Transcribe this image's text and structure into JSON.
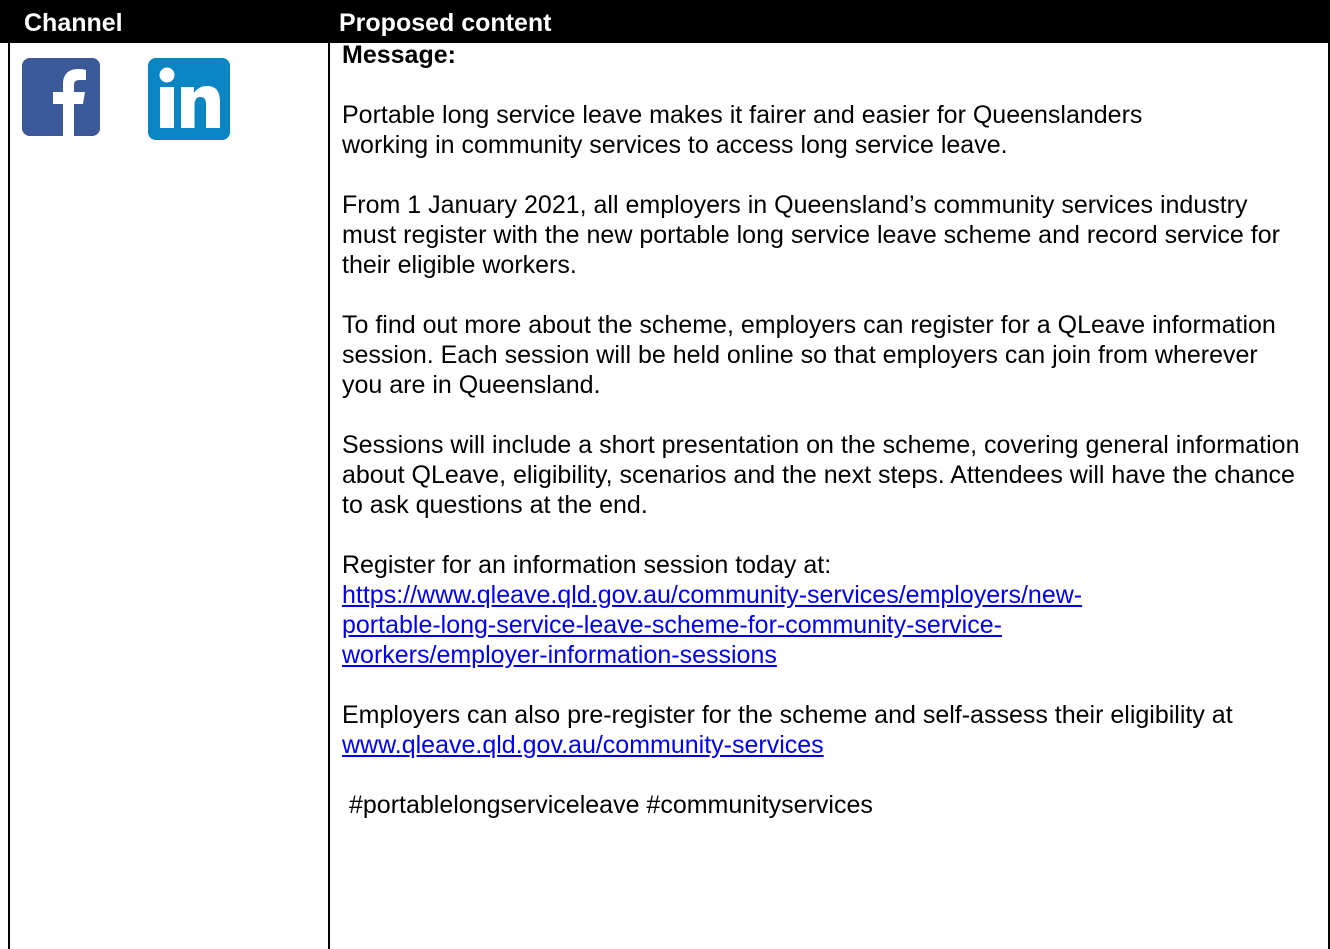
{
  "table": {
    "header": {
      "channel": "Channel",
      "content": "Proposed content"
    },
    "channel_icons": [
      "facebook-icon",
      "linkedin-icon"
    ],
    "colors": {
      "facebook": "#3b5998",
      "linkedin": "#0a85c4",
      "link": "#0000ee"
    },
    "message": {
      "heading": "Message:",
      "p1": "Portable long service leave makes it fairer and easier for Queenslanders working in community services to access long service leave.",
      "p2": "From 1 January 2021, all employers in Queensland’s community services industry must register with the new portable long service leave scheme and record service for their eligible workers.",
      "p3": "To find out more about the scheme, employers can register for a QLeave information session. Each session will be held online so that employers can join from wherever you are in Queensland.",
      "p4": "Sessions will include a short presentation on the scheme, covering general information about QLeave, eligibility, scenarios and the next steps. Attendees will have the chance to ask questions at the end.",
      "p5_text": "Register for an information session today at:",
      "p5_link": "https://www.qleave.qld.gov.au/community-services/employers/new-portable-long-service-leave-scheme-for-community-service-workers/employer-information-sessions",
      "p6_text": "Employers can also pre-register for the scheme and self-assess their eligibility at ",
      "p6_link": "www.qleave.qld.gov.au/community-services",
      "hashtags": "#portablelongserviceleave #communityservices"
    }
  }
}
